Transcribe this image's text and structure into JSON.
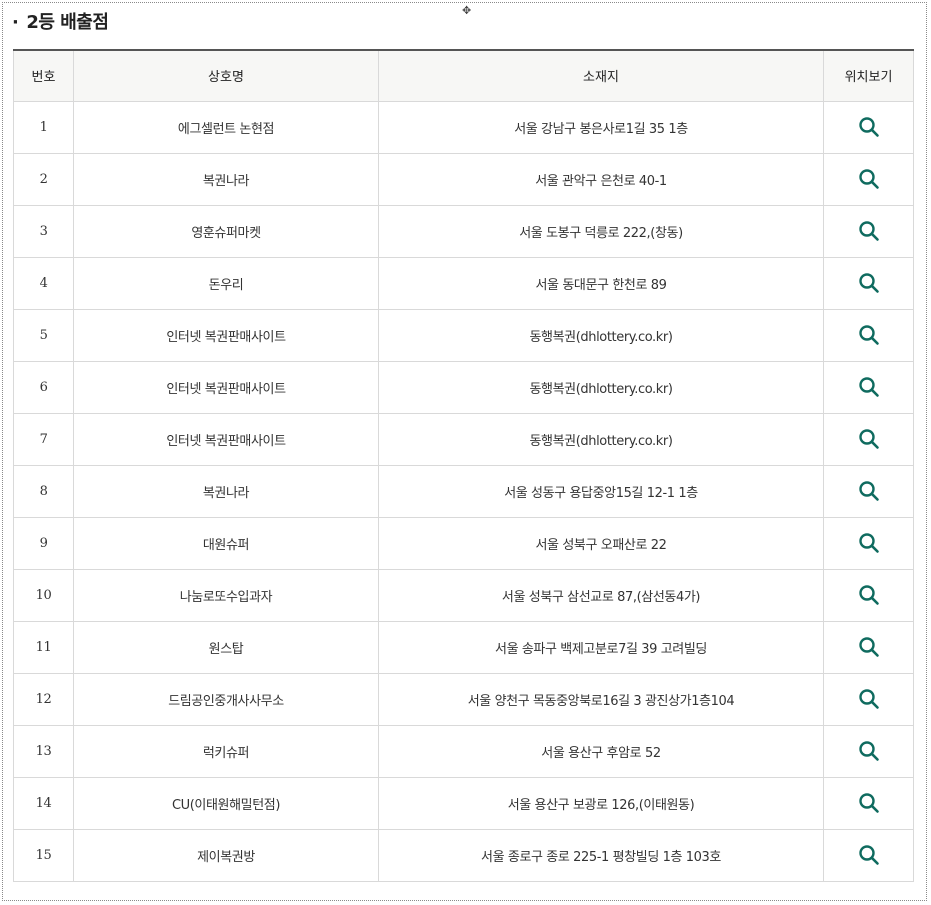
{
  "section": {
    "bullet": "·",
    "title": "2등 배출점"
  },
  "table": {
    "headers": {
      "no": "번호",
      "name": "상호명",
      "address": "소재지",
      "location": "위치보기"
    },
    "rows": [
      {
        "no": "1",
        "name": "에그셀런트 논현점",
        "address": "서울 강남구 봉은사로1길 35 1층"
      },
      {
        "no": "2",
        "name": "복권나라",
        "address": "서울 관악구 은천로 40-1"
      },
      {
        "no": "3",
        "name": "영훈슈퍼마켓",
        "address": "서울 도봉구 덕릉로 222,(창동)"
      },
      {
        "no": "4",
        "name": "돈우리",
        "address": "서울 동대문구 한천로 89"
      },
      {
        "no": "5",
        "name": "인터넷 복권판매사이트",
        "address": "동행복권(dhlottery.co.kr)"
      },
      {
        "no": "6",
        "name": "인터넷 복권판매사이트",
        "address": "동행복권(dhlottery.co.kr)"
      },
      {
        "no": "7",
        "name": "인터넷 복권판매사이트",
        "address": "동행복권(dhlottery.co.kr)"
      },
      {
        "no": "8",
        "name": "복권나라",
        "address": "서울 성동구 용답중앙15길 12-1 1층"
      },
      {
        "no": "9",
        "name": "대원슈퍼",
        "address": "서울 성북구 오패산로 22"
      },
      {
        "no": "10",
        "name": "나눔로또수입과자",
        "address": "서울 성북구 삼선교로 87,(삼선동4가)"
      },
      {
        "no": "11",
        "name": "원스탑",
        "address": "서울 송파구 백제고분로7길 39 고려빌딩"
      },
      {
        "no": "12",
        "name": "드림공인중개사사무소",
        "address": "서울 양천구 목동중앙북로16길 3 광진상가1층104"
      },
      {
        "no": "13",
        "name": "럭키슈퍼",
        "address": "서울 용산구 후암로 52"
      },
      {
        "no": "14",
        "name": "CU(이태원해밀턴점)",
        "address": "서울 용산구 보광로 126,(이태원동)"
      },
      {
        "no": "15",
        "name": "제이복권방",
        "address": "서울 종로구 종로 225-1 평창빌딩 1층 103호"
      }
    ]
  },
  "icons": {
    "location": "search-icon",
    "cursor": "move-cursor-icon"
  },
  "colors": {
    "icon": "#0f6b5f",
    "header_bg": "#f7f7f5",
    "border": "#d9d9d9",
    "top_border": "#555555"
  }
}
